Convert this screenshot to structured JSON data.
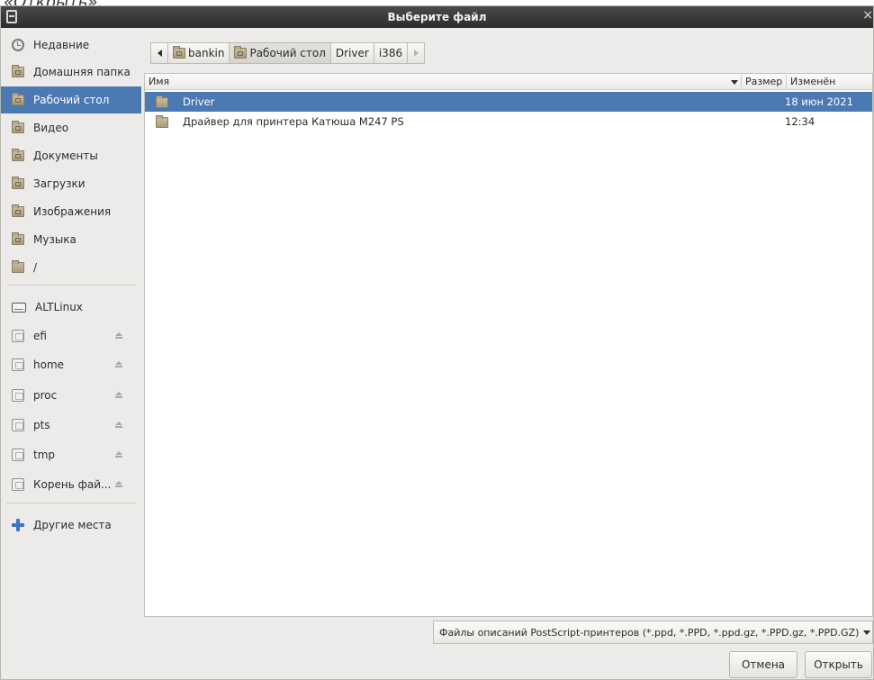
{
  "caption": "«Открыть».",
  "window": {
    "title": "Выберите файл",
    "close": "×"
  },
  "sidebar": {
    "places": [
      {
        "label": "Недавние",
        "icon": "clock-icon"
      },
      {
        "label": "Домашняя папка",
        "icon": "home-folder-icon"
      },
      {
        "label": "Рабочий стол",
        "icon": "desktop-folder-icon",
        "selected": true
      },
      {
        "label": "Видео",
        "icon": "video-folder-icon"
      },
      {
        "label": "Документы",
        "icon": "documents-folder-icon"
      },
      {
        "label": "Загрузки",
        "icon": "downloads-folder-icon"
      },
      {
        "label": "Изображения",
        "icon": "pictures-folder-icon"
      },
      {
        "label": "Музыка",
        "icon": "music-folder-icon"
      },
      {
        "label": "/",
        "icon": "root-folder-icon"
      }
    ],
    "devices": [
      {
        "label": "ALTLinux",
        "icon": "drive-icon",
        "eject": false
      },
      {
        "label": "efi",
        "icon": "mount-icon",
        "eject": true
      },
      {
        "label": "home",
        "icon": "mount-icon",
        "eject": true
      },
      {
        "label": "proc",
        "icon": "mount-icon",
        "eject": true
      },
      {
        "label": "pts",
        "icon": "mount-icon",
        "eject": true
      },
      {
        "label": "tmp",
        "icon": "mount-icon",
        "eject": true
      },
      {
        "label": "Корень фай...",
        "icon": "mount-icon",
        "eject": true
      }
    ],
    "other": {
      "label": "Другие места",
      "icon": "plus-icon"
    }
  },
  "pathbar": {
    "crumbs": [
      "bankin",
      "Рабочий стол",
      "Driver",
      "i386"
    ],
    "active_index": 1
  },
  "columns": {
    "name": "Имя",
    "size": "Размер",
    "modified": "Изменён"
  },
  "files": [
    {
      "name": "Driver",
      "size": "",
      "modified": "18 июн 2021",
      "selected": true
    },
    {
      "name": "Драйвер для принтера Катюша M247 PS",
      "size": "",
      "modified": "12:34",
      "selected": false
    }
  ],
  "filter": {
    "value": "Файлы описаний PostScript-принтеров (*.ppd, *.PPD, *.ppd.gz, *.PPD.gz, *.PPD.GZ)"
  },
  "buttons": {
    "cancel": "Отмена",
    "open": "Открыть"
  },
  "colors": {
    "selection": "#4a79b4",
    "titlebar": "#333333",
    "background": "#ecebe9"
  }
}
